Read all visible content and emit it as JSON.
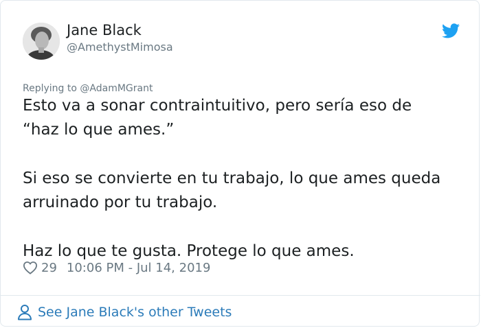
{
  "tweet": {
    "author": {
      "name": "Jane Black",
      "handle": "@AmethystMimosa",
      "avatar_icon": "avatar-portrait"
    },
    "brand_icon": "twitter-bird-icon",
    "brand_color": "#1da1f2",
    "reply_prefix": "Replying to ",
    "reply_to": "@AdamMGrant",
    "paragraphs": [
      [
        "Esto va a sonar contraintuitivo, pero sería eso de",
        "“haz lo que ames.”"
      ],
      [
        "Si eso se convierte en tu trabajo, lo que ames queda",
        "arruinado por tu trabajo."
      ],
      [
        "Haz lo que te gusta. Protege lo que ames."
      ]
    ],
    "likes": "29",
    "timestamp": "10:06 PM - Jul 14, 2019"
  },
  "footer": {
    "link_label": "See Jane Black's other Tweets",
    "icon": "person-icon",
    "link_color": "#2b7bb9"
  }
}
